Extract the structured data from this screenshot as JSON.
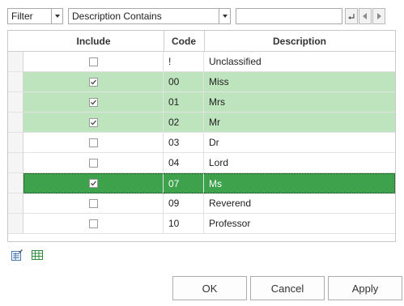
{
  "filter_bar": {
    "mode_value": "Filter",
    "condition_value": "Description Contains",
    "search_value": ""
  },
  "grid": {
    "headers": {
      "include": "Include",
      "code": "Code",
      "description": "Description"
    },
    "rows": [
      {
        "include": false,
        "code": "!",
        "description": "Unclassified",
        "state": "normal"
      },
      {
        "include": true,
        "code": "00",
        "description": "Miss",
        "state": "highlighted"
      },
      {
        "include": true,
        "code": "01",
        "description": "Mrs",
        "state": "highlighted"
      },
      {
        "include": true,
        "code": "02",
        "description": "Mr",
        "state": "highlighted"
      },
      {
        "include": false,
        "code": "03",
        "description": "Dr",
        "state": "normal"
      },
      {
        "include": false,
        "code": "04",
        "description": "Lord",
        "state": "normal"
      },
      {
        "include": true,
        "code": "07",
        "description": "Ms",
        "state": "selected"
      },
      {
        "include": false,
        "code": "09",
        "description": "Reverend",
        "state": "normal"
      },
      {
        "include": false,
        "code": "10",
        "description": "Professor",
        "state": "normal"
      }
    ]
  },
  "colors": {
    "highlight": "#bde4bd",
    "selected": "#3ea24d"
  },
  "icons": {
    "left_tool": "edit-list-icon",
    "right_tool": "grid-icon"
  },
  "buttons": {
    "ok": "OK",
    "cancel": "Cancel",
    "apply": "Apply"
  }
}
